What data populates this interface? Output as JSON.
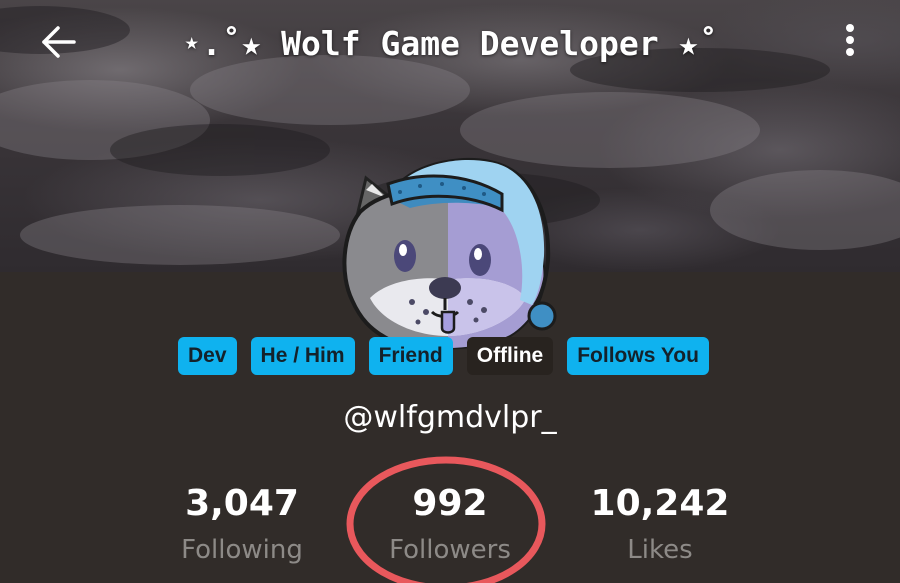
{
  "header": {
    "title": "⋆.˚★ Wolf Game Developer ★˚",
    "back_icon": "arrow-left-icon",
    "menu_icon": "more-vertical-icon"
  },
  "badges": [
    {
      "label": "Dev",
      "color": "#0fb2ef"
    },
    {
      "label": "He / Him",
      "color": "#0fb2ef"
    },
    {
      "label": "Friend",
      "color": "#0fb2ef"
    },
    {
      "label": "Offline",
      "color": "#28231f"
    },
    {
      "label": "Follows You",
      "color": "#0fb2ef"
    }
  ],
  "profile": {
    "handle": "@wlfgmdvlpr_"
  },
  "stats": {
    "following": {
      "value": "3,047",
      "label": "Following"
    },
    "followers": {
      "value": "992",
      "label": "Followers"
    },
    "likes": {
      "value": "10,242",
      "label": "Likes"
    }
  },
  "colors": {
    "background": "#312c29",
    "badge": "#0fb2ef",
    "highlight_ring": "#e8585c"
  }
}
